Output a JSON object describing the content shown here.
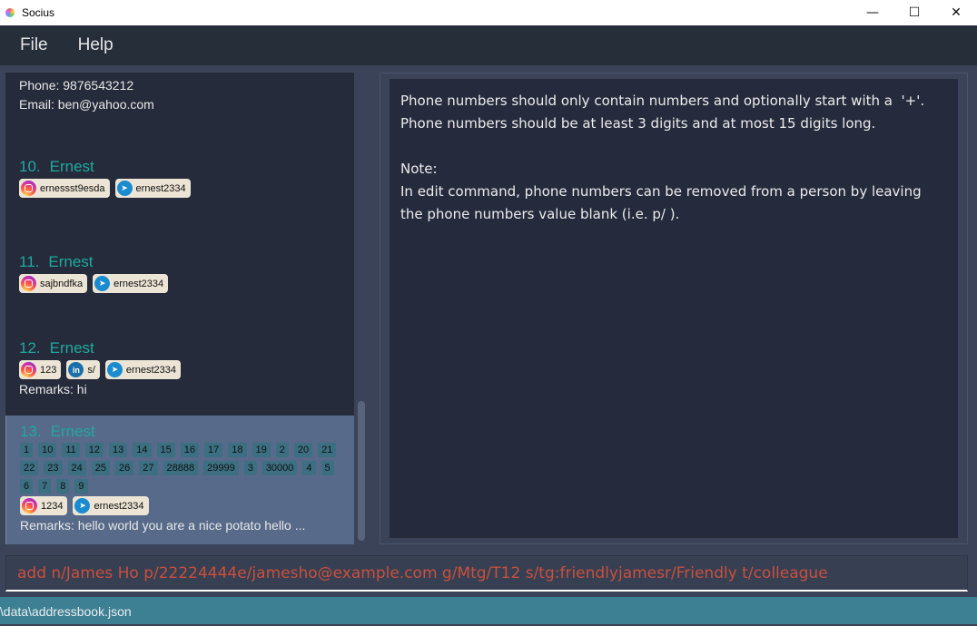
{
  "window": {
    "title": "Socius",
    "minimize": "—",
    "maximize": "☐",
    "close": "✕"
  },
  "menu": [
    "File",
    "Help"
  ],
  "persons": {
    "top": {
      "phone": "Phone: 9876543212",
      "email": "Email: ben@yahoo.com"
    },
    "p10": {
      "index": "10.",
      "name": "Ernest",
      "instagram": "ernessst9esda",
      "telegram": "ernest2334"
    },
    "p11": {
      "index": "11.",
      "name": "Ernest",
      "instagram": "sajbndfka",
      "telegram": "ernest2334"
    },
    "p12": {
      "index": "12.",
      "name": "Ernest",
      "instagram": "123",
      "linkedin": "s/",
      "telegram": "ernest2334",
      "remarks": "Remarks: hi"
    },
    "p13": {
      "index": "13.",
      "name": "Ernest",
      "tags": [
        "1",
        "10",
        "11",
        "12",
        "13",
        "14",
        "15",
        "16",
        "17",
        "18",
        "19",
        "2",
        "20",
        "21",
        "22",
        "23",
        "24",
        "25",
        "26",
        "27",
        "28888",
        "29999",
        "3",
        "30000",
        "4",
        "5",
        "6",
        "7",
        "8",
        "9"
      ],
      "instagram": "1234",
      "telegram": "ernest2334",
      "remarks": "Remarks: hello world you are a nice potato  hello ..."
    }
  },
  "result": "Phone numbers should only contain numbers and optionally start with a  '+'.\nPhone numbers should be at least 3 digits and at most 15 digits long.\n\nNote:\nIn edit command, phone numbers can be removed from a person by leaving\nthe phone numbers value blank (i.e. p/ ).",
  "command": "add n/James Ho p/22224444e/jamesho@example.com g/Mtg/T12 s/tg:friendlyjamesr/Friendly t/colleague",
  "status": ".\\data\\addressbook.json"
}
